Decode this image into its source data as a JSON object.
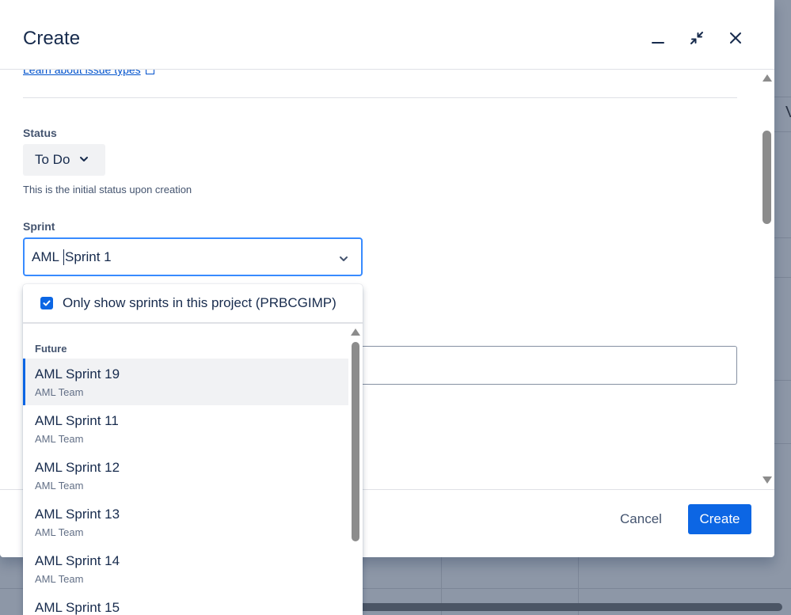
{
  "modal": {
    "title": "Create",
    "learn_link": "Learn about issue types"
  },
  "status_field": {
    "label": "Status",
    "value": "To Do",
    "helper": "This is the initial status upon creation"
  },
  "sprint_field": {
    "label": "Sprint",
    "input_before_cursor": "AML ",
    "input_after_cursor": "Sprint 1"
  },
  "dropdown": {
    "filter_label": "Only show sprints in this project (PRBCGIMP)",
    "filter_checked": true,
    "group_label": "Future",
    "items": [
      {
        "name": "AML Sprint 19",
        "team": "AML Team"
      },
      {
        "name": "AML Sprint 11",
        "team": "AML Team"
      },
      {
        "name": "AML Sprint 12",
        "team": "AML Team"
      },
      {
        "name": "AML Sprint 13",
        "team": "AML Team"
      },
      {
        "name": "AML Sprint 14",
        "team": "AML Team"
      },
      {
        "name": "AML Sprint 15",
        "team": ""
      }
    ]
  },
  "footer": {
    "cancel_label": "Cancel",
    "create_label": "Create"
  },
  "background": {
    "partial_glyph": "V"
  },
  "colors": {
    "primary": "#0c66e4",
    "focus_border": "#388bff",
    "text": "#172b4d"
  },
  "icons": {
    "minimize": "minimize-icon",
    "collapse": "collapse-icon",
    "close": "close-icon",
    "chevron": "chevron-down-icon",
    "external": "external-link-icon",
    "check": "checkmark-icon"
  }
}
